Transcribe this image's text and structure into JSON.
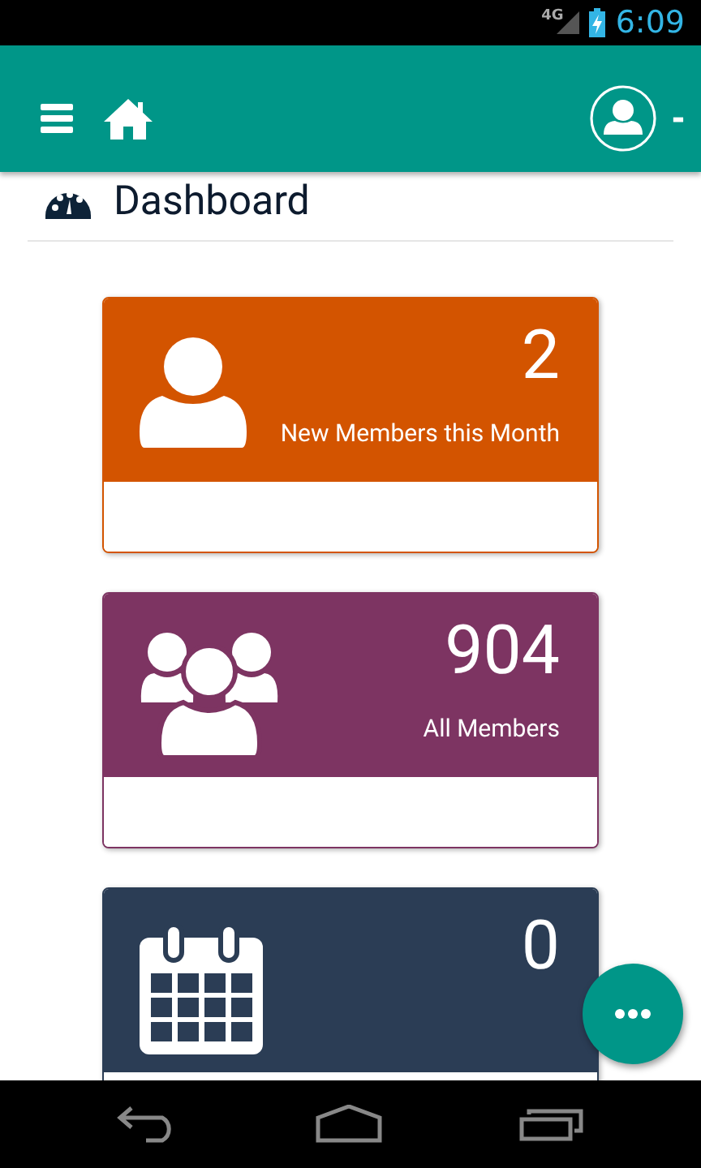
{
  "status_bar": {
    "network": "4G",
    "time": "6:09"
  },
  "toolbar": {
    "user_name": "-"
  },
  "page": {
    "title": "Dashboard"
  },
  "cards": [
    {
      "kind": "user",
      "color": "#d35400",
      "value": "2",
      "label": "New Members this Month"
    },
    {
      "kind": "users",
      "color": "#7d3462",
      "value": "904",
      "label": "All Members"
    },
    {
      "kind": "calendar",
      "color": "#2b3d55",
      "value": "0"
    }
  ]
}
